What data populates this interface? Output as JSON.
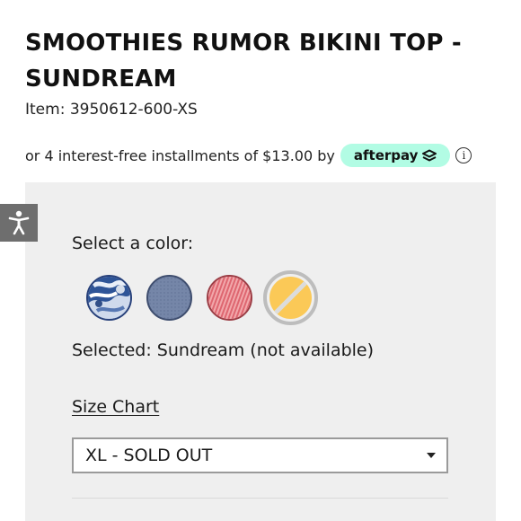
{
  "product": {
    "title": "SMOOTHIES RUMOR BIKINI TOP - SUNDREAM",
    "item_line": "Item: 3950612-600-XS"
  },
  "afterpay": {
    "text": "or 4 interest-free installments of $13.00 by",
    "badge_label": "afterpay",
    "badge_color": "#b2fce4",
    "info_glyph": "i"
  },
  "accessibility": {
    "icon": "accessibility-person-icon",
    "color": "#6e6e6e"
  },
  "color_selector": {
    "label": "Select a color:",
    "swatches": [
      {
        "name": "blue tie-dye",
        "colors": [
          "#2b4c8c",
          "#c9d6ea",
          "#ffffff"
        ],
        "selected": false,
        "available": true
      },
      {
        "name": "slate blue",
        "colors": [
          "#7385a8"
        ],
        "selected": false,
        "available": true
      },
      {
        "name": "coral stripe",
        "colors": [
          "#e06a72",
          "#f0a2a6"
        ],
        "selected": false,
        "available": true
      },
      {
        "name": "Sundream",
        "colors": [
          "#fbc957"
        ],
        "selected": true,
        "available": false
      }
    ],
    "selected_text": "Selected: Sundream (not available)"
  },
  "size": {
    "chart_link": "Size Chart",
    "selected_value": "XL - SOLD OUT"
  }
}
